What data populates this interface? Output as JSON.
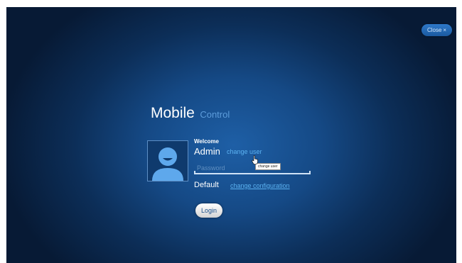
{
  "header": {
    "close_label": "Close"
  },
  "title": {
    "main": "Mobile",
    "sub": "Control"
  },
  "login": {
    "welcome": "Welcome",
    "user": "Admin",
    "change_user": "change user",
    "password_placeholder": "Password",
    "tooltip": "change user",
    "configuration": "Default",
    "change_configuration": "change configuration",
    "login_label": "Login"
  },
  "icons": {
    "close": "close-x-icon",
    "avatar": "user-avatar-icon",
    "cursor": "hand-cursor-icon"
  },
  "colors": {
    "background": "#154985",
    "accent_link": "#5cb3f2",
    "title_sub": "#5d9ddc",
    "text": "#ffffff"
  }
}
